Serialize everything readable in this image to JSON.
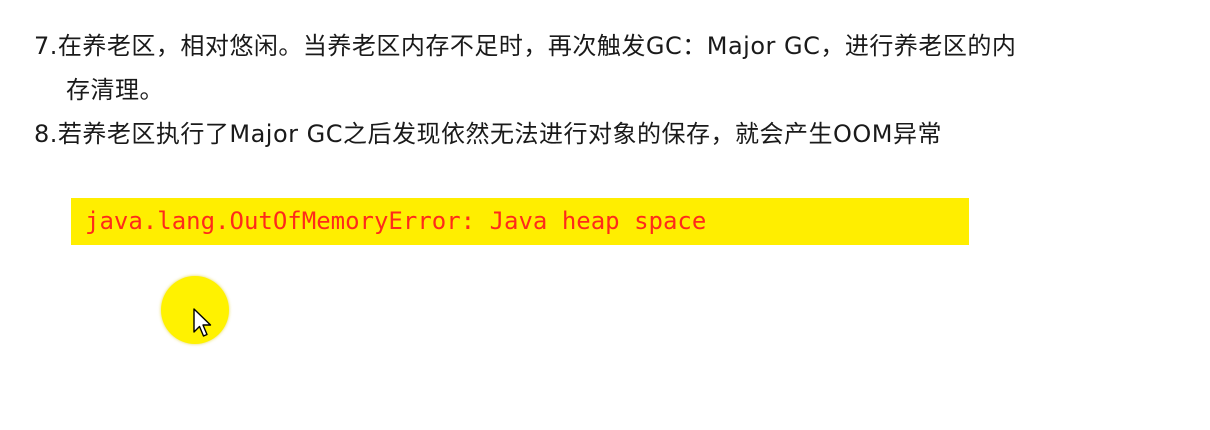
{
  "content": {
    "item7_line1": "7.在养老区，相对悠闲。当养老区内存不足时，再次触发GC：Major GC，进行养老区的内",
    "item7_line2": "存清理。",
    "item8": "8.若养老区执行了Major GC之后发现依然无法进行对象的保存，就会产生OOM异常",
    "error_message": "java.lang.OutOfMemoryError: Java heap space"
  },
  "colors": {
    "highlight_background": "#ffee00",
    "error_text": "#ff2a1a",
    "cursor_halo": "#fff200",
    "body_text": "#1a1a1a"
  },
  "icons": {
    "cursor": "mouse-pointer-icon"
  }
}
